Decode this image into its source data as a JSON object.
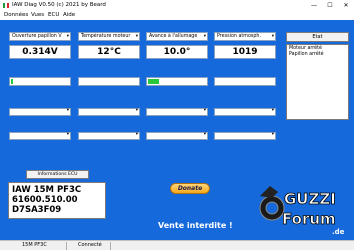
{
  "window": {
    "title": "IAW Diag V0.50  (c) 2021 by Beard",
    "minimize": "—",
    "maximize": "☐",
    "close": "✕"
  },
  "menu": [
    "Données",
    "Vues",
    "ECU",
    "Aide"
  ],
  "sensors": [
    {
      "label": "Ouverture papillon V",
      "value": "0.314V"
    },
    {
      "label": "Température moteur",
      "value": "12°C"
    },
    {
      "label": "Avance à l'allumage",
      "value": "10.0°"
    },
    {
      "label": "Pression atmosph.",
      "value": "1019"
    }
  ],
  "bars": [
    {
      "level": 0.06
    },
    {
      "level": 0
    },
    {
      "level": 0.22
    },
    {
      "level": 0
    }
  ],
  "etat_button": "Etat",
  "status_lines": [
    "Moteur arrêté",
    "Papillon arrêté"
  ],
  "ecu": {
    "button": "Informations ECU",
    "lines": [
      "IAW 15M PF3C",
      "61600.510.00",
      "D7SA3F09"
    ]
  },
  "donate_label": "Donate",
  "vente_text": "Vente interdite !",
  "logo": {
    "top": "GUZZI",
    "bottom": "Forum",
    "suffix": ".de"
  },
  "statusbar": {
    "ecu": "15M PF3C",
    "state": "Connecté"
  },
  "colors": {
    "background": "#1669db",
    "bar_fill": "#28c83c",
    "donate": "#f7a81b"
  }
}
